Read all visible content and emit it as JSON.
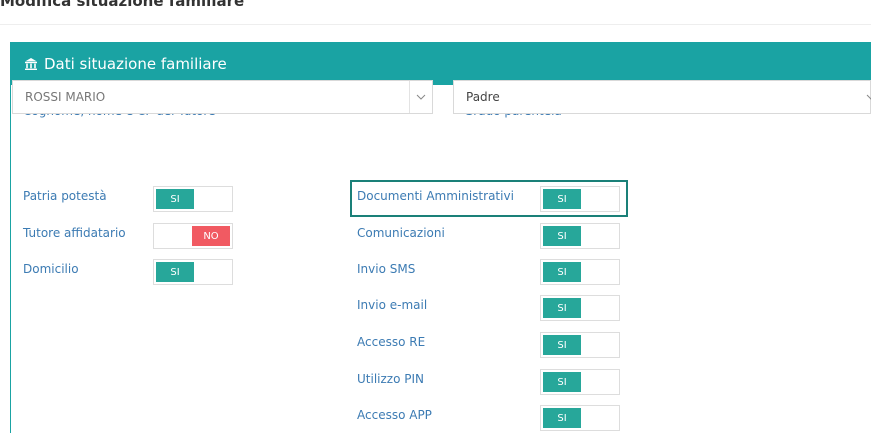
{
  "page": {
    "title": "Modifica situazione familiare"
  },
  "panel": {
    "title": "Dati situazione familiare",
    "icon": "institution-icon"
  },
  "tutor_field": {
    "label": "Cognome, nome e CF del Tutore",
    "required_mark": "*",
    "value": "ROSSI MARIO"
  },
  "grado_field": {
    "label": "Grado parentela",
    "required_mark": "*",
    "value": "Padre"
  },
  "left_toggles": [
    {
      "label": "Patria potestà",
      "value": "SI"
    },
    {
      "label": "Tutore affidatario",
      "value": "NO"
    },
    {
      "label": "Domicilio",
      "value": "SI"
    }
  ],
  "right_toggles": [
    {
      "label": "Documenti Amministrativi",
      "value": "SI"
    },
    {
      "label": "Comunicazioni",
      "value": "SI"
    },
    {
      "label": "Invio SMS",
      "value": "SI"
    },
    {
      "label": "Invio e-mail",
      "value": "SI"
    },
    {
      "label": "Accesso RE",
      "value": "SI"
    },
    {
      "label": "Utilizzo PIN",
      "value": "SI"
    },
    {
      "label": "Accesso APP",
      "value": "SI"
    }
  ],
  "colors": {
    "header_bg": "#1aa3a3",
    "toggle_on": "#27a79a",
    "toggle_off": "#f15a62",
    "label": "#3c7bb3",
    "required": "#e04848",
    "highlight_border": "#1a8078"
  }
}
